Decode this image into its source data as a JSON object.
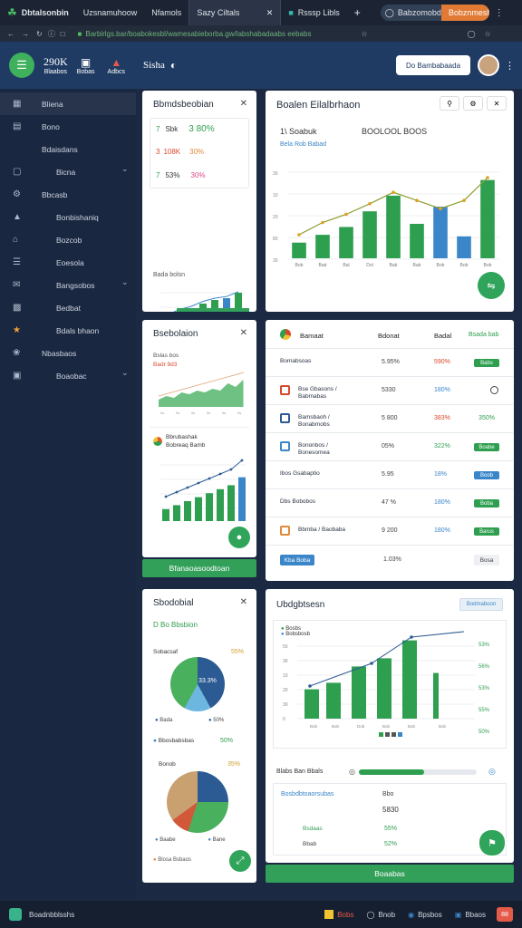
{
  "browser": {
    "tabs": [
      {
        "label": "Dbtalsonbin"
      },
      {
        "label": "Uzsnamuhoow"
      },
      {
        "label": "Nfamols"
      },
      {
        "label": "Sazy Ciltals"
      },
      {
        "label": "Rsssp Libls"
      }
    ],
    "new_tab": "+",
    "search_placeholder": "Babzomobd",
    "orange_tab": "Bobznmeshn",
    "url": "Barbirlgs.bar/boabokesbl/wamesabieborba.gw/labshabadaabs eebabs"
  },
  "app": {
    "stat1_value": "290K",
    "stat1_label": "Blaabos",
    "stat2_label": "Bobas",
    "stat3_label": "Adbcs",
    "brand": "Sisha",
    "cta_button": "Do Bambabaada"
  },
  "sidebar": {
    "items": [
      {
        "label": "Bliena",
        "icon": "grid-icon"
      },
      {
        "label": "Bono",
        "icon": "image-icon"
      },
      {
        "label": "Bdaisdans",
        "icon": "none"
      },
      {
        "label": "Bicna",
        "icon": "square-icon"
      },
      {
        "label": "Bbcasb",
        "icon": "gear-icon"
      },
      {
        "label": "Bonbishaniq",
        "icon": "chart-icon"
      },
      {
        "label": "Bozcob",
        "icon": "home-icon"
      },
      {
        "label": "Eoesola",
        "icon": "doc-icon"
      },
      {
        "label": "Bangsobos",
        "icon": "mail-icon"
      },
      {
        "label": "Bedbat",
        "icon": "file-icon"
      },
      {
        "label": "Bdals bhaon",
        "icon": "star-icon"
      },
      {
        "label": "Nbasbaos",
        "icon": "settings-icon"
      },
      {
        "label": "Boaobac",
        "icon": "box-icon"
      }
    ]
  },
  "panel_a": {
    "title": "Bbmdsbeobian",
    "stats": [
      {
        "prefix": "7",
        "label": "Sbk",
        "value": "3 80%"
      },
      {
        "prefix": "3",
        "label": "108K",
        "value": "30%"
      },
      {
        "prefix": "7",
        "label": "53%",
        "value": "30%"
      }
    ],
    "caption": "Bada bolsn"
  },
  "panel_b": {
    "title": "Boalen Eilalbrhaon",
    "subtitle": "1\\ Soabuk",
    "value": "BOOLOOL BOOS",
    "legend": "Bela Rob Babad",
    "y_ticks": [
      "30",
      "10",
      "20",
      "80",
      "30"
    ],
    "categories": [
      "Bob",
      "Bad",
      "Bal",
      "Dol",
      "Bab",
      "Bab",
      "Bob",
      "Bob",
      "Bob"
    ]
  },
  "panel_c": {
    "title": "Bsebolaion",
    "label1": "Bslas bos",
    "label2": "Badr 9d3",
    "label3": "Bbrubashak",
    "label4": "Bobreaq Bamb",
    "bottom_button": "Bfanaoasoodtoan"
  },
  "table": {
    "headers": [
      "Bamaat",
      "Bdonat",
      "Badal",
      "Bsada bab"
    ],
    "rows": [
      {
        "name": "Bomabsoas",
        "a": "5.95%",
        "b": "590%",
        "status": "Babs"
      },
      {
        "name": "Bse Gbasons / Babmabas",
        "a": "5330",
        "b": "180%",
        "status": ""
      },
      {
        "name": "Bamsbaoh / Bonabmobs",
        "a": "5 800",
        "b": "383%",
        "status": "350%"
      },
      {
        "name": "Bononbos / Bonesomea",
        "a": "05%",
        "b": "322%",
        "status": "Boabe"
      },
      {
        "name": "Ibos Gsabaptio",
        "a": "5.95",
        "b": "18%",
        "status": "Boob"
      },
      {
        "name": "Dbs Bobobos",
        "a": "47 %",
        "b": "180%",
        "status": "Boba"
      },
      {
        "name": "Bbmba / Baobaba",
        "a": "9 200",
        "b": "180%",
        "status": "Barus"
      }
    ],
    "footer_button": "Kba Boba",
    "footer_value": "1.03%",
    "footer_status": "Bosa"
  },
  "panel_d": {
    "title": "Sbodobial",
    "subtitle": "D Bo Bbsbion",
    "pie1_label": "Sobacsaf",
    "pie1_pct": "55%",
    "pie1_center": "33.3%",
    "pie1_legend": [
      "Bada",
      "50%"
    ],
    "pie2_label": "Bbosbabsbas",
    "pie2_pct": "50%",
    "pie3_label": "Bonob",
    "pie3_pct": "35%",
    "pie3_legend": [
      "Baabe",
      "Bane"
    ],
    "pie3_extra": "Blosa Bsbaos"
  },
  "panel_e": {
    "title": "Ubdgbtsesn",
    "button": "Bodmaboon",
    "y_ticks": [
      "50",
      "30",
      "10",
      "20",
      "30",
      "0"
    ],
    "legend1": "Bosbs",
    "legend2": "Bobsbosb",
    "right_pcts": [
      "53%",
      "56%",
      "53%",
      "55%",
      "50%"
    ],
    "categories": [
      "Bob",
      "Bob",
      "Dob",
      "Bob",
      "Bob",
      "Bob"
    ],
    "progress_label": "Blabs Ban Bbals",
    "progress": 0.55,
    "section_link": "Bosbdbtoaorsubas",
    "section_value1": "Bbo",
    "section_value2": "5830",
    "rows": [
      {
        "label": "Bsdaas",
        "value": "55%"
      },
      {
        "label": "Bbab",
        "value": "52%"
      }
    ],
    "bottom_button": "Boaabas"
  },
  "footer": {
    "app_name": "Boadnbblsshs",
    "items": [
      "Bobs",
      "Bnob",
      "Bpsbos",
      "Bbaos"
    ],
    "badge": "88"
  },
  "chart_data": [
    {
      "type": "bar",
      "categories": [
        "Bob",
        "Bad",
        "Bal",
        "Dol",
        "Bab",
        "Bab",
        "Bob",
        "Bob",
        "Bob"
      ],
      "series": [
        {
          "name": "Bela Rob Babad",
          "values": [
            10,
            15,
            20,
            30,
            40,
            22,
            33,
            14,
            50
          ]
        }
      ]
    }
  ]
}
